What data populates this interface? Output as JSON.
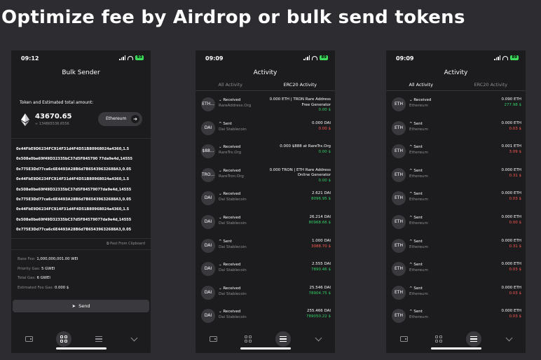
{
  "headline": "Optimize fee by Airdrop or bulk send tokens",
  "bulk": {
    "time": "09:12",
    "battery": "93",
    "title": "Bulk Sender",
    "total_label": "Token and Estimated total amount:",
    "total": "43670.65",
    "total_sub": "≈ 134865536.6556",
    "network": "Ethereum",
    "addresses": [
      "0x44FbE9D6234FC914F31d4F4D51B80968024a4360,1.5",
      "0x508e0be69f49D32335bC37d5F845790 77da9e4d,14555",
      "0x775E3Dd77ca6c6E4493A28B6d7B65439632688A3,0.05",
      "0x44FbE9D6234FC914F31d4F4D51B80968024a4360,1.5",
      "0x508e0be69f49D32335bC37d5F84579077da9e4d,14555",
      "0x775E3Dd77ca6c6E4493A28B6d7B65439632688A3,0.05",
      "0x44FbE9D6234FC914F31d4F4D51B80968024a4360,1.5",
      "0x508e0be69f49D32335bC37d5F84579077da9e4d,14555",
      "0x775E3Dd77ca6c6E4493A28B6d7B65439632688A3,0.05"
    ],
    "paste": "⧉ Past From Clipboard",
    "fees": [
      {
        "k": "Base Fee:",
        "v": "1,000,000,001.00 WEI"
      },
      {
        "k": "Priority Gas:",
        "v": "5 GWEI"
      },
      {
        "k": "Total Gas:",
        "v": "6 GWEI"
      },
      {
        "k": "Estimated Fee Gas:",
        "v": "0.000 $"
      }
    ],
    "send": "Send"
  },
  "act1": {
    "time": "09:09",
    "battery": "89",
    "title": "Activity",
    "tabs": [
      "All Activity",
      "ERC20 Activity"
    ],
    "rows": [
      {
        "av": "ETH...",
        "dir": "⌄ Received",
        "name": "RareAddress.Org",
        "amt": "0.000 ETH | TRON Rare Address Free Generator",
        "usd": "0.00 $",
        "color": "green",
        "tall": true
      },
      {
        "av": "DAI",
        "dir": "^ Sent",
        "name": "Dai Stablecoin",
        "amt": "0.000 DAI",
        "usd": "0.00 $",
        "color": "red",
        "tall": false
      },
      {
        "av": "$88...",
        "dir": "⌄ Received",
        "name": "RareTrx.Org",
        "amt": "0.000 $888 at RareTrx.Org",
        "usd": "0.00 $",
        "color": "green",
        "tall": false
      },
      {
        "av": "TRO...",
        "dir": "⌄ Received",
        "name": "RareTron.Org",
        "amt": "0.000 TRON | ETH Rare Address Online Generator",
        "usd": "0.00 $",
        "color": "green",
        "tall": true
      },
      {
        "av": "DAI",
        "dir": "⌄ Received",
        "name": "Dai Stablecoin",
        "amt": "2.621 DAI",
        "usd": "8096.95 $",
        "color": "green",
        "tall": false
      },
      {
        "av": "DAI",
        "dir": "⌄ Received",
        "name": "Dai Stablecoin",
        "amt": "26.214 DAI",
        "usd": "80968.66 $",
        "color": "green",
        "tall": false
      },
      {
        "av": "DAI",
        "dir": "^ Sent",
        "name": "Dai Stablecoin",
        "amt": "1.000 DAI",
        "usd": "3088.70 $",
        "color": "red",
        "tall": false
      },
      {
        "av": "DAI",
        "dir": "⌄ Received",
        "name": "Dai Stablecoin",
        "amt": "2.555 DAI",
        "usd": "7890.46 $",
        "color": "green",
        "tall": false
      },
      {
        "av": "DAI",
        "dir": "⌄ Received",
        "name": "Dai Stablecoin",
        "amt": "25.546 DAI",
        "usd": "78904.75 $",
        "color": "green",
        "tall": false
      },
      {
        "av": "DAI",
        "dir": "⌄ Received",
        "name": "Dai Stablecoin",
        "amt": "255.466 DAI",
        "usd": "789050.22 $",
        "color": "green",
        "tall": false
      }
    ]
  },
  "act2": {
    "time": "09:09",
    "battery": "89",
    "title": "Activity",
    "tabs": [
      "All Activity",
      "ERC20 Activity"
    ],
    "rows": [
      {
        "av": "ETH",
        "dir": "⌄ Received",
        "name": "Ethereum",
        "amt": "0.090 ETH",
        "usd": "277.98 $",
        "color": "green"
      },
      {
        "av": "ETH",
        "dir": "^ Sent",
        "name": "Ethereum",
        "amt": "0.000 ETH",
        "usd": "0.03 $",
        "color": "red"
      },
      {
        "av": "ETH",
        "dir": "^ Sent",
        "name": "Ethereum",
        "amt": "0.001 ETH",
        "usd": "3.09 $",
        "color": "red"
      },
      {
        "av": "ETH",
        "dir": "^ Sent",
        "name": "Ethereum",
        "amt": "0.000 ETH",
        "usd": "0.31 $",
        "color": "red"
      },
      {
        "av": "ETH",
        "dir": "^ Sent",
        "name": "Ethereum",
        "amt": "0.000 ETH",
        "usd": "0.03 $",
        "color": "red"
      },
      {
        "av": "ETH",
        "dir": "^ Sent",
        "name": "Ethereum",
        "amt": "0.000 ETH",
        "usd": "0.00 $",
        "color": "red"
      },
      {
        "av": "ETH",
        "dir": "^ Sent",
        "name": "Ethereum",
        "amt": "0.000 ETH",
        "usd": "0.31 $",
        "color": "red"
      },
      {
        "av": "ETH",
        "dir": "^ Sent",
        "name": "Ethereum",
        "amt": "0.000 ETH",
        "usd": "0.03 $",
        "color": "red"
      },
      {
        "av": "ETH",
        "dir": "^ Sent",
        "name": "Ethereum",
        "amt": "0.000 ETH",
        "usd": "0.03 $",
        "color": "red"
      },
      {
        "av": "ETH",
        "dir": "^ Sent",
        "name": "Ethereum",
        "amt": "0.000 ETH",
        "usd": "0.03 $",
        "color": "red"
      }
    ]
  },
  "nav_icons": [
    "wallet-icon",
    "grid-icon",
    "list-icon",
    "chevron-down-icon"
  ],
  "colors": {
    "green": "#33d067",
    "red": "#ff5a4f",
    "battery": "#3ddc5b"
  }
}
